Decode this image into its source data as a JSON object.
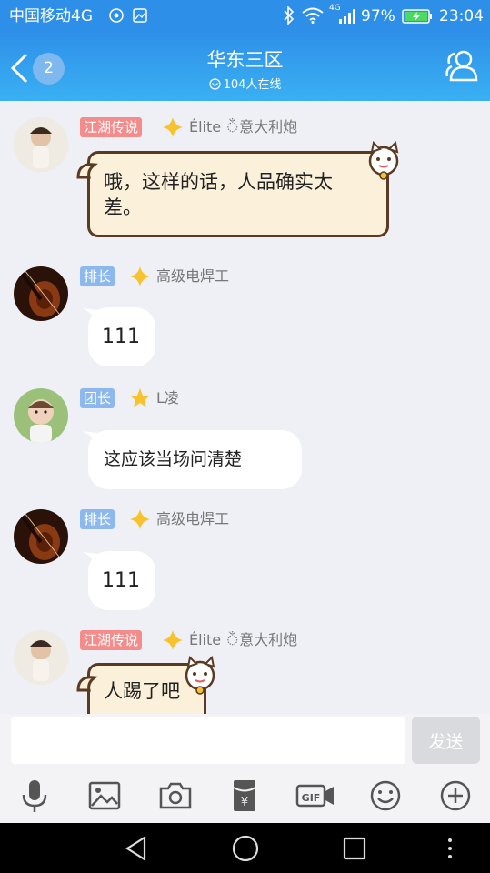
{
  "status_bar": {
    "carrier": "中国移动4G",
    "network_small": "4G",
    "battery": "97%",
    "time": "23:04"
  },
  "header": {
    "back_count": "2",
    "title": "华东三区",
    "online": "104人在线"
  },
  "messages": [
    {
      "avatar": "child-photo-avatar",
      "tag": "江湖传说",
      "tag_color": "#f58c8c",
      "star": "gold",
      "name": "Élite ঁ意大利炮",
      "text_lines": [
        "哦，这样的话，人品确实太",
        "差。"
      ],
      "style": "themed-cat"
    },
    {
      "avatar": "violin-avatar",
      "tag": "排长",
      "tag_color": "#8cb8ee",
      "star": "gold",
      "name": "高级电焊工",
      "text_lines": [
        "111"
      ],
      "style": "plain"
    },
    {
      "avatar": "baby-avatar",
      "tag": "团长",
      "tag_color": "#8cb8ee",
      "star": "gold-filled",
      "name": "L凌",
      "text_lines": [
        "这应该当场问清楚"
      ],
      "style": "plain"
    },
    {
      "avatar": "violin-avatar",
      "tag": "排长",
      "tag_color": "#8cb8ee",
      "star": "gold",
      "name": "高级电焊工",
      "text_lines": [
        "111"
      ],
      "style": "plain"
    },
    {
      "avatar": "child-photo-avatar",
      "tag": "江湖传说",
      "tag_color": "#f58c8c",
      "star": "gold",
      "name": "Élite ঁ意大利炮",
      "text_lines": [
        "人踢了吧"
      ],
      "style": "themed-cat"
    }
  ],
  "input": {
    "value": "",
    "send_label": "发送"
  },
  "toolbar": [
    "microphone-icon",
    "image-icon",
    "camera-icon",
    "red-packet-icon",
    "gif-icon",
    "emoji-icon",
    "plus-icon"
  ],
  "colors": {
    "header_blue": "#2e8fe8",
    "tag_pink": "#f58c8c",
    "tag_blue": "#8cb8ee",
    "bubble_theme": "#fbf0d9"
  }
}
